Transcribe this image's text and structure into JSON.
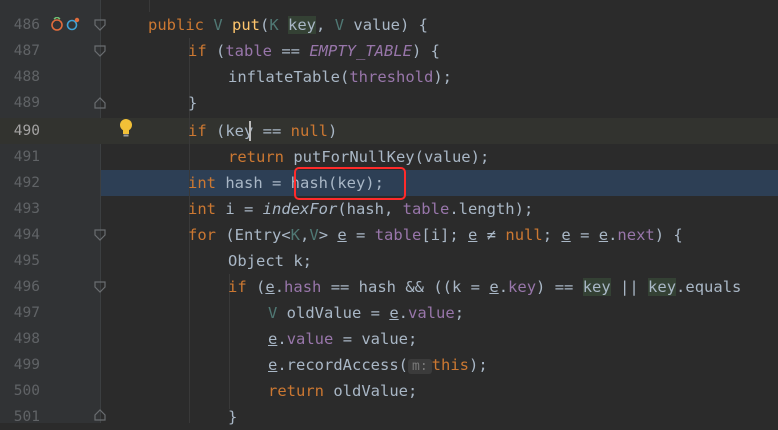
{
  "gutter": {
    "line_numbers": [
      "486",
      "487",
      "488",
      "489",
      "490",
      "491",
      "492",
      "493",
      "494",
      "495",
      "496",
      "497",
      "498",
      "499",
      "500",
      "501"
    ]
  },
  "code": {
    "l486": {
      "kw1": "public ",
      "t1": "V ",
      "fn": "put",
      "p1": "(",
      "t2": "K ",
      "var": "key",
      ", ": ", ",
      "t3": "V ",
      "rest": "value) {"
    },
    "l487": {
      "kw": "if ",
      "p1": "(",
      "fld": "table",
      " eq": " == ",
      "sfld": "EMPTY_TABLE",
      "rest": ") {"
    },
    "l488": {
      "a": "inflateTable(",
      "fld": "threshold",
      "rest": ");"
    },
    "l489": {
      "rest": "}"
    },
    "l490": {
      "kw": "if ",
      "a": "(ke",
      "b": "y",
      "op": " == ",
      "kw2": "null",
      "rest": ")"
    },
    "l491": {
      "kw": "return ",
      "rest": "putForNullKey(value);"
    },
    "l492": {
      "kw": "int ",
      "a": "hash = ",
      "b": "hash(key);"
    },
    "l493": {
      "kw": "int ",
      "a": "i = ",
      "it": "indexFor",
      "b": "(hash, ",
      "fld": "table",
      "c": ".length);"
    },
    "l494": {
      "kw": "for ",
      "a": "(Entry<",
      "t1": "K",
      "comma": ",",
      "t2": "V",
      "b": "> ",
      "e1": "e",
      " eq": " = ",
      "fld": "table",
      "c": "[i]; ",
      "e2": "e",
      " ne": " ≠ ",
      "kw2": "null",
      "d": "; ",
      "e3": "e",
      " eq2": " = ",
      "e4": "e",
      ".": ".",
      "fld2": "next",
      ") {": ") {"
    },
    "l495": {
      "a": "Object k;"
    },
    "l496": {
      "kw": "if ",
      "a": "(",
      "e1": "e",
      ".": ".",
      "fld1": "hash",
      "b": " == hash && ((k = ",
      "e2": "e",
      ".2": ".",
      "fld2": "key",
      "c": ") == ",
      "v1": "key",
      "d": " || ",
      "v2": "key",
      "e": ".equals"
    },
    "l497": {
      "t": "V ",
      "a": "oldValue = ",
      "e": "e",
      ".": ".",
      "fld": "value",
      ";": ";"
    },
    "l498": {
      "e": "e",
      ".": ".",
      "fld": "value",
      "a": " = value;"
    },
    "l499": {
      "e": "e",
      "a": ".recordAccess(",
      "hint": "m:",
      "kw": "this",
      "b": ");"
    },
    "l500": {
      "kw": "return ",
      "a": "oldValue;"
    },
    "l501": {
      "a": "}"
    }
  },
  "colors": {
    "keyword": "#cc7832",
    "function": "#ffc66d",
    "field": "#9876aa",
    "highlight_box": "#ff2b2b"
  },
  "icons": [
    "override-implementation-icon",
    "debug-marker-icon",
    "fold-arrow-icon",
    "intention-bulb-icon"
  ]
}
